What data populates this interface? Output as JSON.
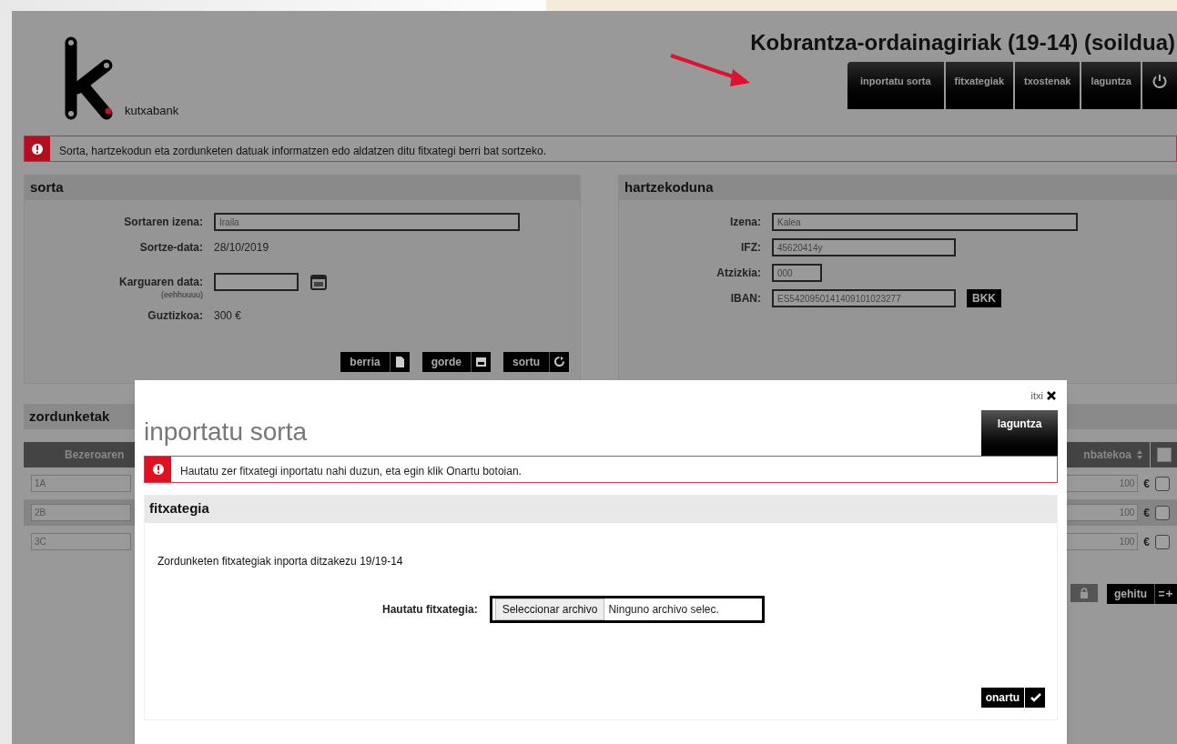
{
  "header": {
    "logo_text": "kutxabank",
    "title": "Kobrantza-ordainagiriak (19-14) (soildua)"
  },
  "nav": [
    {
      "label": "inportatu sorta",
      "kind": "text"
    },
    {
      "label": "fitxategiak",
      "kind": "text"
    },
    {
      "label": "txostenak",
      "kind": "text"
    },
    {
      "label": "laguntza",
      "kind": "text"
    },
    {
      "kind": "power"
    }
  ],
  "info": "Sorta, hartzekodun eta zordunketen datuak informatzen edo aldatzen ditu fitxategi berri bat sortzeko.",
  "sorta": {
    "title": "sorta",
    "fields": [
      {
        "label": "Sortaren izena:",
        "kind": "input",
        "value": "Iraila"
      },
      {
        "label": "Sortze-data:",
        "kind": "text",
        "value": "28/10/2019"
      },
      {
        "label": "Karguaren data:",
        "kind": "date",
        "hint": "(eehhuuuu)"
      },
      {
        "label": "Guztizkoa:",
        "kind": "text",
        "value": "300 €"
      }
    ],
    "buttons": [
      {
        "label": "berria",
        "kind": "new"
      },
      {
        "label": "gorde",
        "kind": "save"
      },
      {
        "label": "sortu",
        "kind": "generate"
      }
    ]
  },
  "hartzekoduna": {
    "title": "hartzekoduna",
    "fields": [
      {
        "label": "Izena:",
        "kind": "input",
        "value": "Kalea"
      },
      {
        "label": "IFZ:",
        "kind": "input",
        "value": "45620414y"
      },
      {
        "label": "Atzizkia:",
        "kind": "input",
        "value": "000"
      },
      {
        "label": "IBAN:",
        "kind": "iban",
        "value": "ES5420950141409101023277",
        "button": "BKK"
      }
    ]
  },
  "zordunketak": {
    "title": "zordunketak",
    "columns": [
      "Bezeroaren",
      "nbatekoa"
    ],
    "all_checked": false,
    "rows": [
      {
        "code": "1A",
        "amount": "100",
        "currency": "€",
        "checked": false,
        "selected": false
      },
      {
        "code": "2B",
        "amount": "100",
        "currency": "€",
        "checked": false,
        "selected": true
      },
      {
        "code": "3C",
        "amount": "100",
        "currency": "€",
        "checked": false,
        "selected": false
      }
    ],
    "add_button": "gehitu"
  },
  "modal": {
    "close": "itxi",
    "title": "inportatu sorta",
    "help_tab": "laguntza",
    "info": "Hautatu zer fitxategi inportatu nahi duzun, eta egin klik Onartu botoian.",
    "section": "fitxategia",
    "description": "Zordunketen fitxategiak inporta ditzakezu 19/19-14",
    "file_label": "Hautatu fitxategia:",
    "file_button": "Seleccionar archivo",
    "file_status": "Ninguno archivo selec.",
    "ok_button": "onartu"
  }
}
